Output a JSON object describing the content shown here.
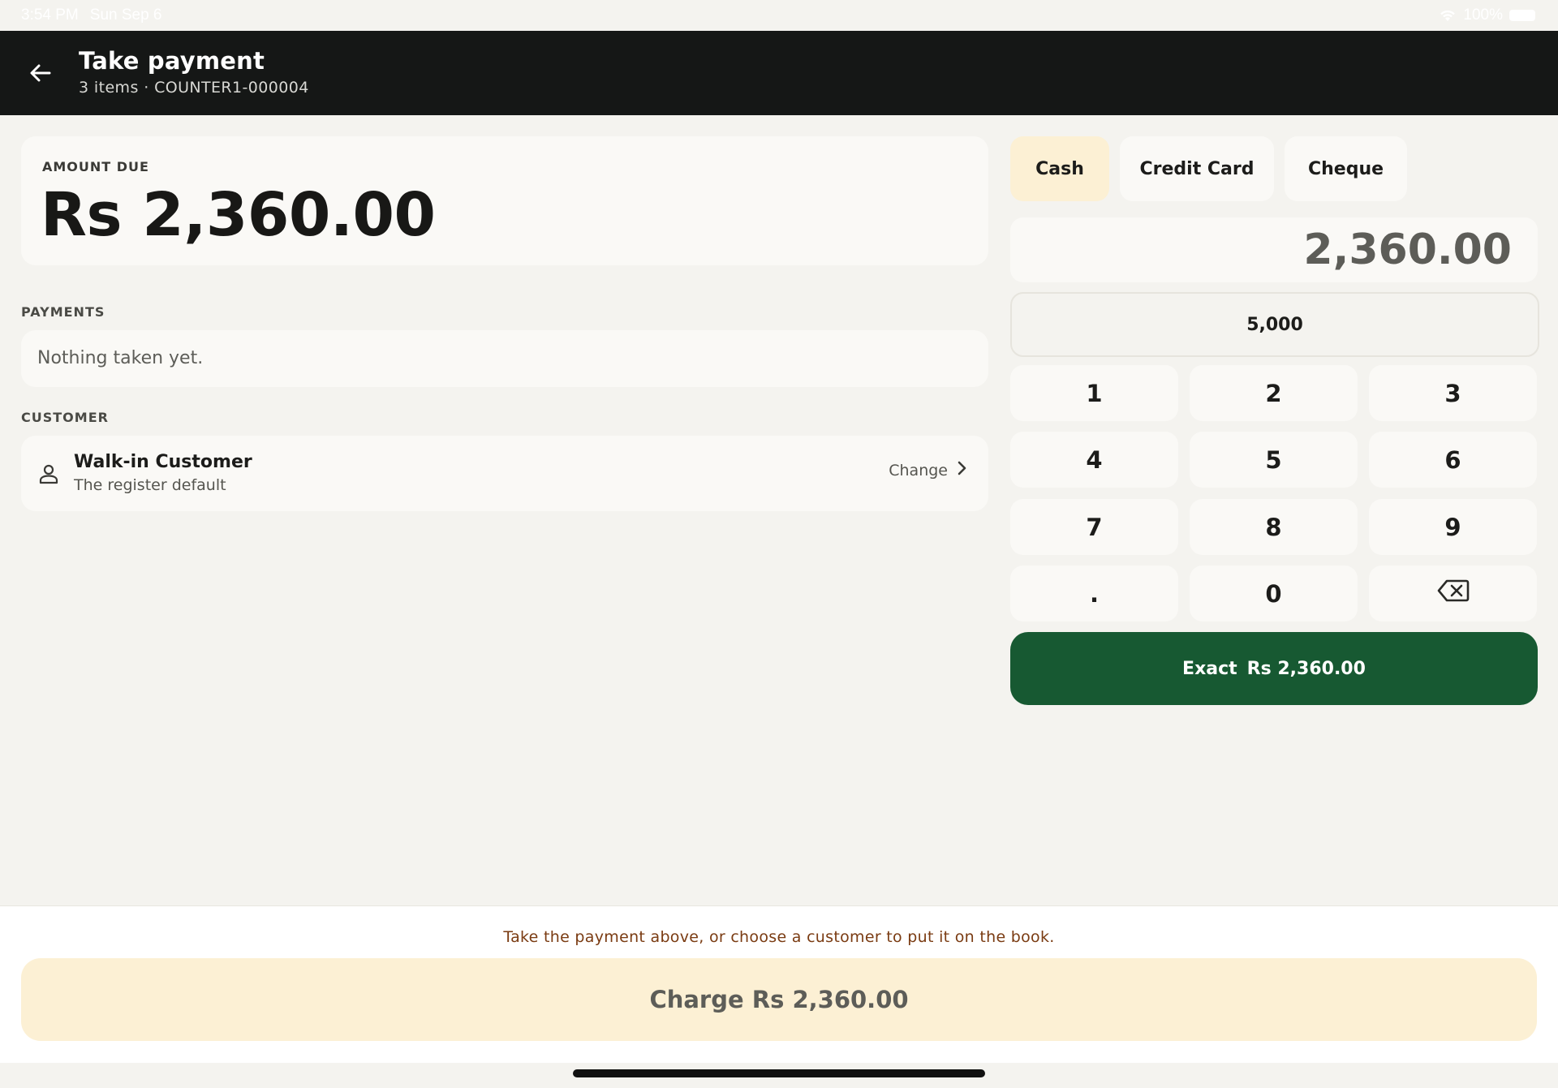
{
  "status_bar": {
    "time": "3:54 PM",
    "date": "Sun Sep 6",
    "battery": "100%",
    "icons": [
      "wifi-icon",
      "battery-icon"
    ]
  },
  "header": {
    "back_icon": "arrow-left-icon",
    "title": "Take payment",
    "subtitle": "3 items · COUNTER1-000004"
  },
  "amount_due": {
    "label": "AMOUNT DUE",
    "value": "Rs 2,360.00"
  },
  "payments": {
    "label": "PAYMENTS",
    "empty_text": "Nothing taken yet."
  },
  "customer": {
    "label": "CUSTOMER",
    "icon": "person-icon",
    "name": "Walk-in Customer",
    "subtitle": "The register default",
    "change_label": "Change",
    "change_icon": "chevron-right-icon"
  },
  "payment_methods": {
    "tabs": [
      {
        "label": "Cash",
        "selected": true
      },
      {
        "label": "Credit Card",
        "selected": false
      },
      {
        "label": "Cheque",
        "selected": false
      }
    ]
  },
  "entry": {
    "value": "2,360.00"
  },
  "quick_amount": {
    "label": "5,000"
  },
  "keypad": {
    "keys": [
      "1",
      "2",
      "3",
      "4",
      "5",
      "6",
      "7",
      "8",
      "9",
      ".",
      "0"
    ],
    "backspace_icon": "backspace-icon"
  },
  "exact_button": {
    "word": "Exact",
    "amount": "Rs 2,360.00"
  },
  "footer": {
    "hint": "Take the payment above, or choose a customer to put it on the book.",
    "charge_label": "Charge Rs 2,360.00"
  },
  "colors": {
    "header_bg": "#151716",
    "accent_green": "#175932",
    "selected_tab": "#fcf0d4",
    "charge_bg": "#fcf0d4",
    "hint_text": "#7a3b12",
    "page_bg": "#f4f3ef"
  }
}
